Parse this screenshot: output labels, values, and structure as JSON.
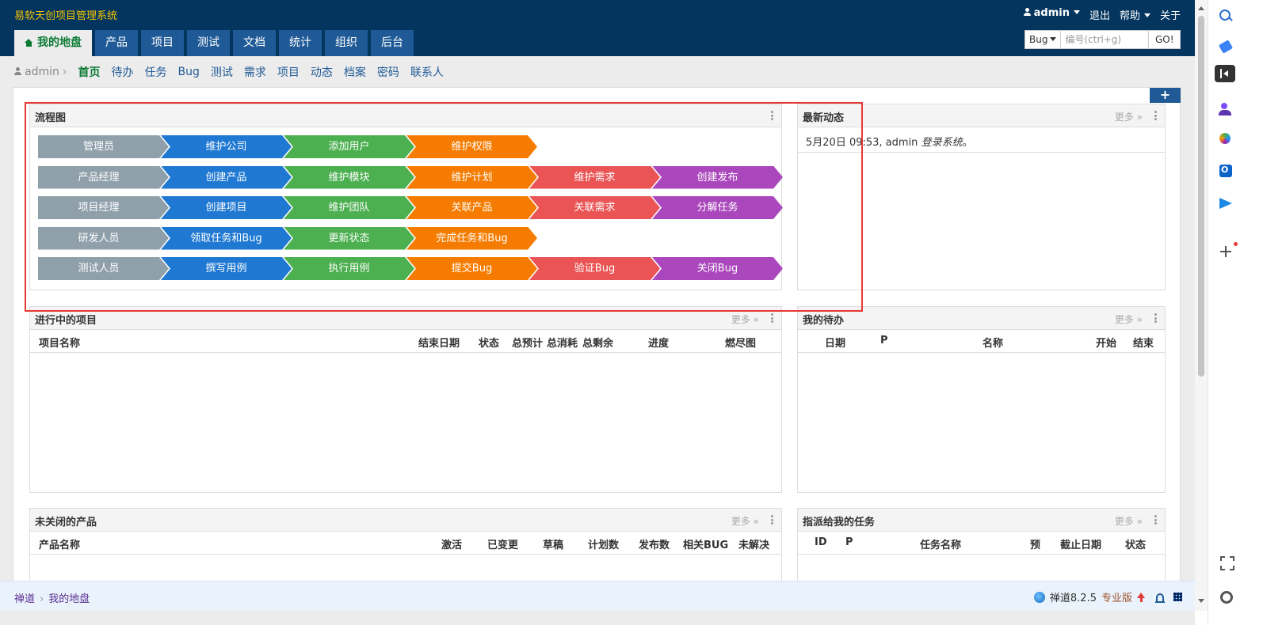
{
  "header": {
    "app_title": "易软天创项目管理系统",
    "user": "admin",
    "logout": "退出",
    "help": "帮助",
    "about": "关于"
  },
  "main_tabs": [
    {
      "label": "我的地盘",
      "active": true
    },
    {
      "label": "产品"
    },
    {
      "label": "项目"
    },
    {
      "label": "测试"
    },
    {
      "label": "文档"
    },
    {
      "label": "统计"
    },
    {
      "label": "组织"
    },
    {
      "label": "后台"
    }
  ],
  "search": {
    "type": "Bug",
    "placeholder": "编号(ctrl+g)",
    "go": "GO!"
  },
  "subnav": {
    "user": "admin",
    "items": [
      "首页",
      "待办",
      "任务",
      "Bug",
      "测试",
      "需求",
      "项目",
      "动态",
      "档案",
      "密码",
      "联系人"
    ]
  },
  "add_block": "+",
  "flowchart": {
    "title": "流程图",
    "rows": [
      [
        "管理员",
        "维护公司",
        "添加用户",
        "维护权限"
      ],
      [
        "产品经理",
        "创建产品",
        "维护模块",
        "维护计划",
        "维护需求",
        "创建发布"
      ],
      [
        "项目经理",
        "创建项目",
        "维护团队",
        "关联产品",
        "关联需求",
        "分解任务"
      ],
      [
        "研发人员",
        "领取任务和Bug",
        "更新状态",
        "完成任务和Bug"
      ],
      [
        "测试人员",
        "撰写用例",
        "执行用例",
        "提交Bug",
        "验证Bug",
        "关闭Bug"
      ]
    ],
    "colors": [
      "#8fa0ab",
      "#1f78d1",
      "#4caf50",
      "#f57c00",
      "#ea5455",
      "#ab47bc"
    ]
  },
  "dynamics": {
    "title": "最新动态",
    "more": "更多",
    "entry": {
      "time": "5月20日 09:53,",
      "user": "admin",
      "action": "登录系统",
      "end": "。"
    }
  },
  "projects": {
    "title": "进行中的项目",
    "more": "更多",
    "columns": [
      "项目名称",
      "结束日期",
      "状态",
      "总预计",
      "总消耗",
      "总剩余",
      "进度",
      "燃尽图"
    ]
  },
  "todos": {
    "title": "我的待办",
    "more": "更多",
    "columns": [
      "日期",
      "P",
      "名称",
      "开始",
      "结束"
    ]
  },
  "products": {
    "title": "未关闭的产品",
    "more": "更多",
    "columns": [
      "产品名称",
      "激活",
      "已变更",
      "草稿",
      "计划数",
      "发布数",
      "相关BUG",
      "未解决"
    ]
  },
  "assigned_tasks": {
    "title": "指派给我的任务",
    "more": "更多",
    "columns": [
      "ID",
      "P",
      "任务名称",
      "预",
      "截止日期",
      "状态"
    ]
  },
  "footer": {
    "crumbs": [
      "禅道",
      "我的地盘"
    ],
    "version": "禅道8.2.5",
    "edition": "专业版"
  }
}
